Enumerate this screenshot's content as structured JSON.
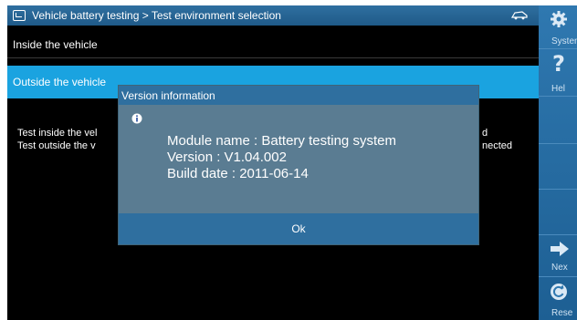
{
  "titlebar": {
    "title": "Vehicle battery testing > Test environment selection"
  },
  "list": [
    {
      "label": "Inside the vehicle"
    },
    {
      "label": "Outside the vehicle"
    }
  ],
  "description": {
    "line1_left": "Test inside the vel",
    "line1_right": "d",
    "line2_left": "Test outside the v",
    "line2_right": "nected"
  },
  "dialog": {
    "title": "Version information",
    "module_line": "Module name : Battery testing system",
    "version_line": "Version : V1.04.002",
    "build_line": "Build date : 2011-06-14",
    "ok_label": "Ok"
  },
  "sidebar": {
    "system_label": "Systen",
    "help_label": "Hel",
    "next_label": "Nex",
    "reset_label": "Rese"
  },
  "colors": {
    "title_bar": "#2f6fa0",
    "selected_item": "#1aa3e0",
    "dialog_bg": "#5a7c92",
    "dialog_bar": "#2f6f9f",
    "sidebar": "#2f78b0"
  }
}
